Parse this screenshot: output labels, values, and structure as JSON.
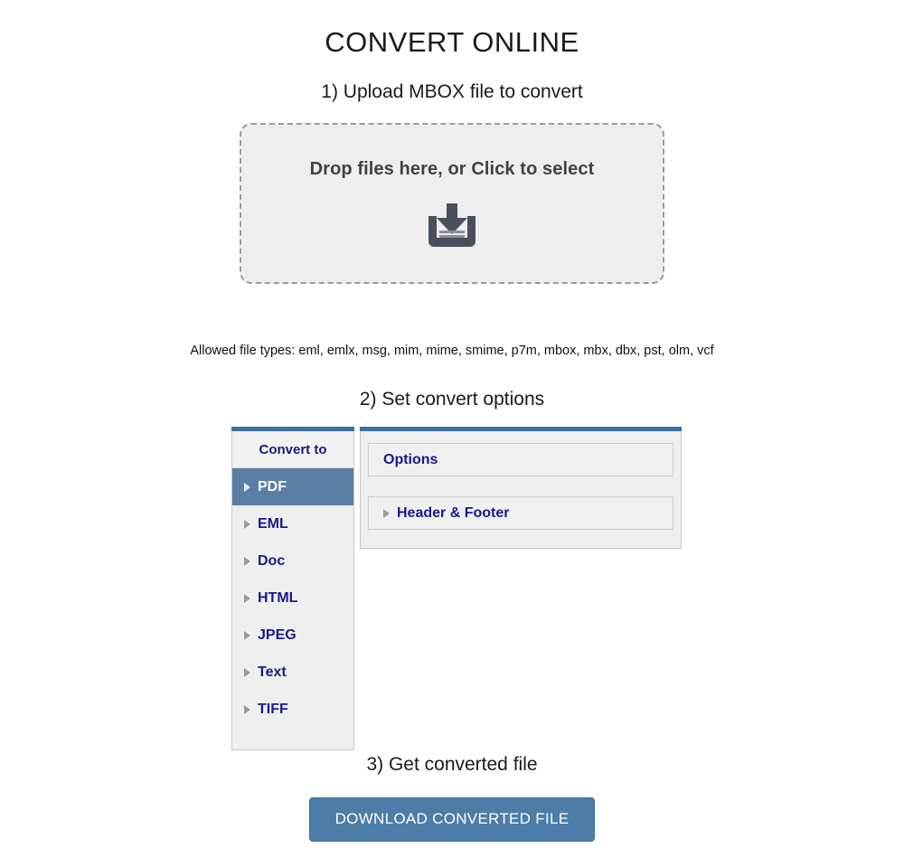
{
  "page": {
    "title": "CONVERT ONLINE"
  },
  "step1": {
    "heading": "1) Upload MBOX file to convert",
    "dropzone": {
      "label": "Drop files here, or Click to select",
      "icon": "download-tray-icon",
      "icon_color": "#4a4f5c",
      "background": "#eeeeee",
      "border_color": "#9a9a9a"
    },
    "allowed_types": "Allowed file types: eml, emlx, msg, mim, mime, smime, p7m, mbox, mbx, dbx, pst, olm, vcf"
  },
  "step2": {
    "heading": "2) Set convert options",
    "convert_panel": {
      "header": "Convert to",
      "selected": "PDF",
      "accent": "#3f6f9f",
      "selected_background": "#5b7ea4",
      "items": [
        {
          "label": "PDF",
          "selected": true
        },
        {
          "label": "EML",
          "selected": false
        },
        {
          "label": "Doc",
          "selected": false
        },
        {
          "label": "HTML",
          "selected": false
        },
        {
          "label": "JPEG",
          "selected": false
        },
        {
          "label": "Text",
          "selected": false
        },
        {
          "label": "TIFF",
          "selected": false
        }
      ]
    },
    "options_panel": {
      "boxes": [
        {
          "label": "Options",
          "has_toggle": false
        },
        {
          "label": "Header & Footer",
          "has_toggle": true
        }
      ]
    }
  },
  "step3": {
    "heading": "3) Get converted file",
    "download_label": "DOWNLOAD CONVERTED FILE",
    "download_color": "#4b7da8"
  }
}
